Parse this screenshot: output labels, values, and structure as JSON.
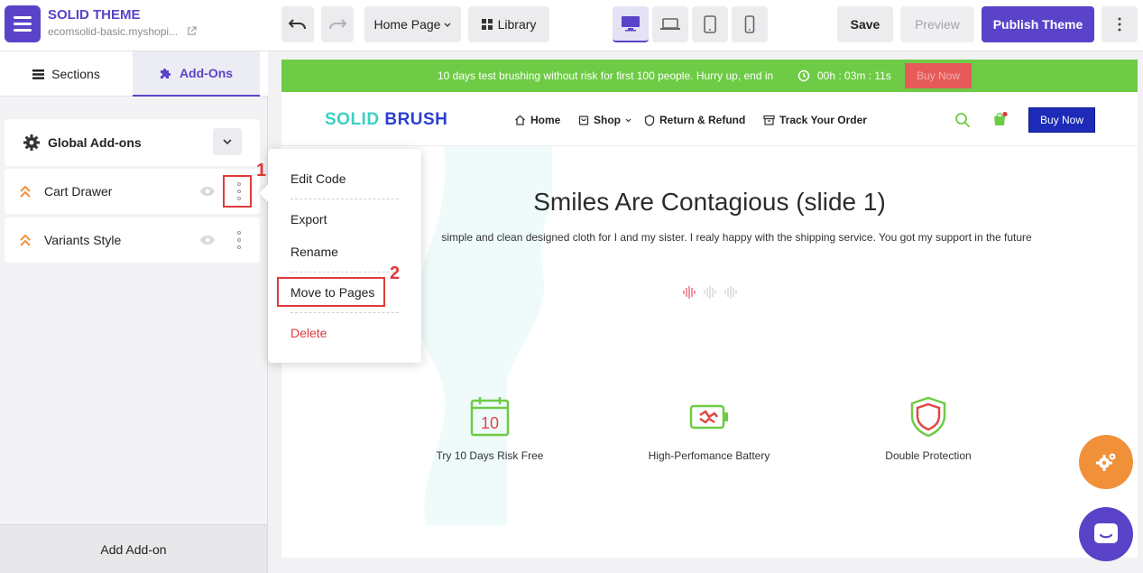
{
  "brand": {
    "title": "SOLID THEME",
    "domain": "ecomsolid-basic.myshopi..."
  },
  "tabs": [
    {
      "label": "Sections",
      "icon": "sections-icon"
    },
    {
      "label": "Add-Ons",
      "icon": "puzzle-icon",
      "active": true
    }
  ],
  "addons": {
    "global_label": "Global Add-ons",
    "items": [
      {
        "label": "Cart Drawer"
      },
      {
        "label": "Variants Style"
      }
    ],
    "add_label": "Add Add-on"
  },
  "toolbar": {
    "page_select": "Home Page",
    "library_label": "Library",
    "save_label": "Save",
    "preview_label": "Preview",
    "publish_label": "Publish Theme"
  },
  "context_menu": {
    "items": [
      {
        "label": "Edit Code"
      },
      {
        "label": "Export"
      },
      {
        "label": "Rename"
      },
      {
        "label": "Move to Pages"
      },
      {
        "label": "Delete"
      }
    ]
  },
  "annotations": {
    "step_1": "1",
    "step_2": "2"
  },
  "preview": {
    "promo": {
      "text": "10 days test brushing without risk for first 100 people. Hurry up, end in",
      "timer": "00h : 03m : 11s",
      "button": "Buy Now"
    },
    "logo": {
      "part1": "SOLID",
      "part2": "BRUSH"
    },
    "nav": [
      {
        "label": "Home"
      },
      {
        "label": "Shop"
      },
      {
        "label": "Return & Refund"
      },
      {
        "label": "Track Your Order"
      }
    ],
    "nav_button": "Buy Now",
    "hero_title": "Smiles Are Contagious (slide 1)",
    "hero_text": "simple and clean designed cloth for I and my sister. I realy happy with the shipping service. You got my support in the future",
    "calendar_number": "10",
    "features": [
      {
        "label": "Try 10 Days Risk Free"
      },
      {
        "label": "High-Perfomance Battery"
      },
      {
        "label": "Double Protection"
      }
    ]
  },
  "colors": {
    "brand": "#5a43c8",
    "promo_bar": "#6ecb45",
    "promo_button": "#e75a5a",
    "nav_button": "#1d2bb8",
    "logo_part1": "#3ad1c4",
    "logo_part2": "#2b3fd1",
    "delete": "#e03a3a",
    "annotation": "#e03a3a",
    "fab_settings": "#f0913a"
  }
}
